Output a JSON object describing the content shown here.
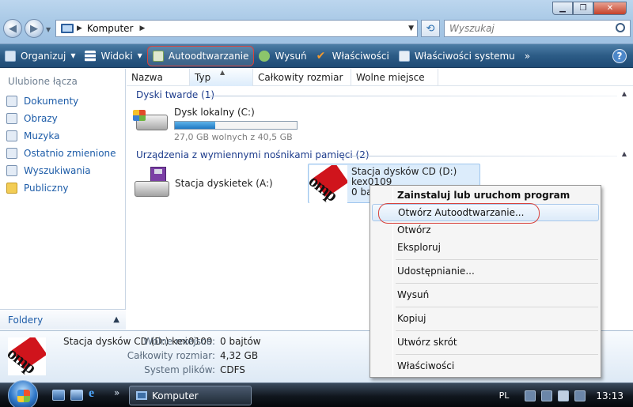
{
  "address": {
    "crumb": "Komputer"
  },
  "search": {
    "placeholder": "Wyszukaj"
  },
  "toolbar": {
    "organize": "Organizuj",
    "views": "Widoki",
    "autoplay": "Autoodtwarzanie",
    "eject": "Wysuń",
    "properties": "Właściwości",
    "system_properties": "Właściwości systemu",
    "more": "»",
    "help": "?"
  },
  "sidebar": {
    "title": "Ulubione łącza",
    "items": [
      {
        "label": "Dokumenty",
        "icon": "documents-icon"
      },
      {
        "label": "Obrazy",
        "icon": "pictures-icon"
      },
      {
        "label": "Muzyka",
        "icon": "music-icon"
      },
      {
        "label": "Ostatnio zmienione",
        "icon": "recent-icon"
      },
      {
        "label": "Wyszukiwania",
        "icon": "searches-icon"
      },
      {
        "label": "Publiczny",
        "icon": "public-folder-icon"
      }
    ],
    "folders": "Foldery"
  },
  "columns": [
    "Nazwa",
    "Typ",
    "Całkowity rozmiar",
    "Wolne miejsce"
  ],
  "groups": {
    "hard_drives": "Dyski twarde (1)",
    "removable": "Urządzenia z wymiennymi nośnikami pamięci (2)"
  },
  "drives": {
    "local": {
      "name": "Dysk lokalny (C:)",
      "space": "27,0 GB wolnych z 40,5 GB",
      "used_fraction": 0.333
    },
    "floppy": {
      "name": "Stacja dyskietek (A:)"
    },
    "cd": {
      "name": "Stacja dysków CD (D:)",
      "label": "kex0109",
      "sub": "0 ba"
    }
  },
  "details": {
    "title": "Stacja dysków CD (D:) kex0109",
    "rows": [
      {
        "k": "Wolne miejsce:",
        "v": "0 bajtów"
      },
      {
        "k": "Całkowity rozmiar:",
        "v": "4,32 GB"
      },
      {
        "k": "System plików:",
        "v": "CDFS"
      }
    ]
  },
  "context_menu": {
    "items": [
      "Zainstaluj lub uruchom program",
      "Otwórz Autoodtwarzanie...",
      "Otwórz",
      "Eksploruj",
      "Udostępnianie...",
      "Wysuń",
      "Kopiuj",
      "Utwórz skrót",
      "Właściwości"
    ]
  },
  "taskbar": {
    "task": "Komputer",
    "lang": "PL",
    "clock": "13:13",
    "more": "»"
  },
  "colors": {
    "toolbar": "#2c5b86",
    "accent_link": "#1d5ca8",
    "highlight_red": "#d8433d",
    "selection": "#dcecfb"
  }
}
